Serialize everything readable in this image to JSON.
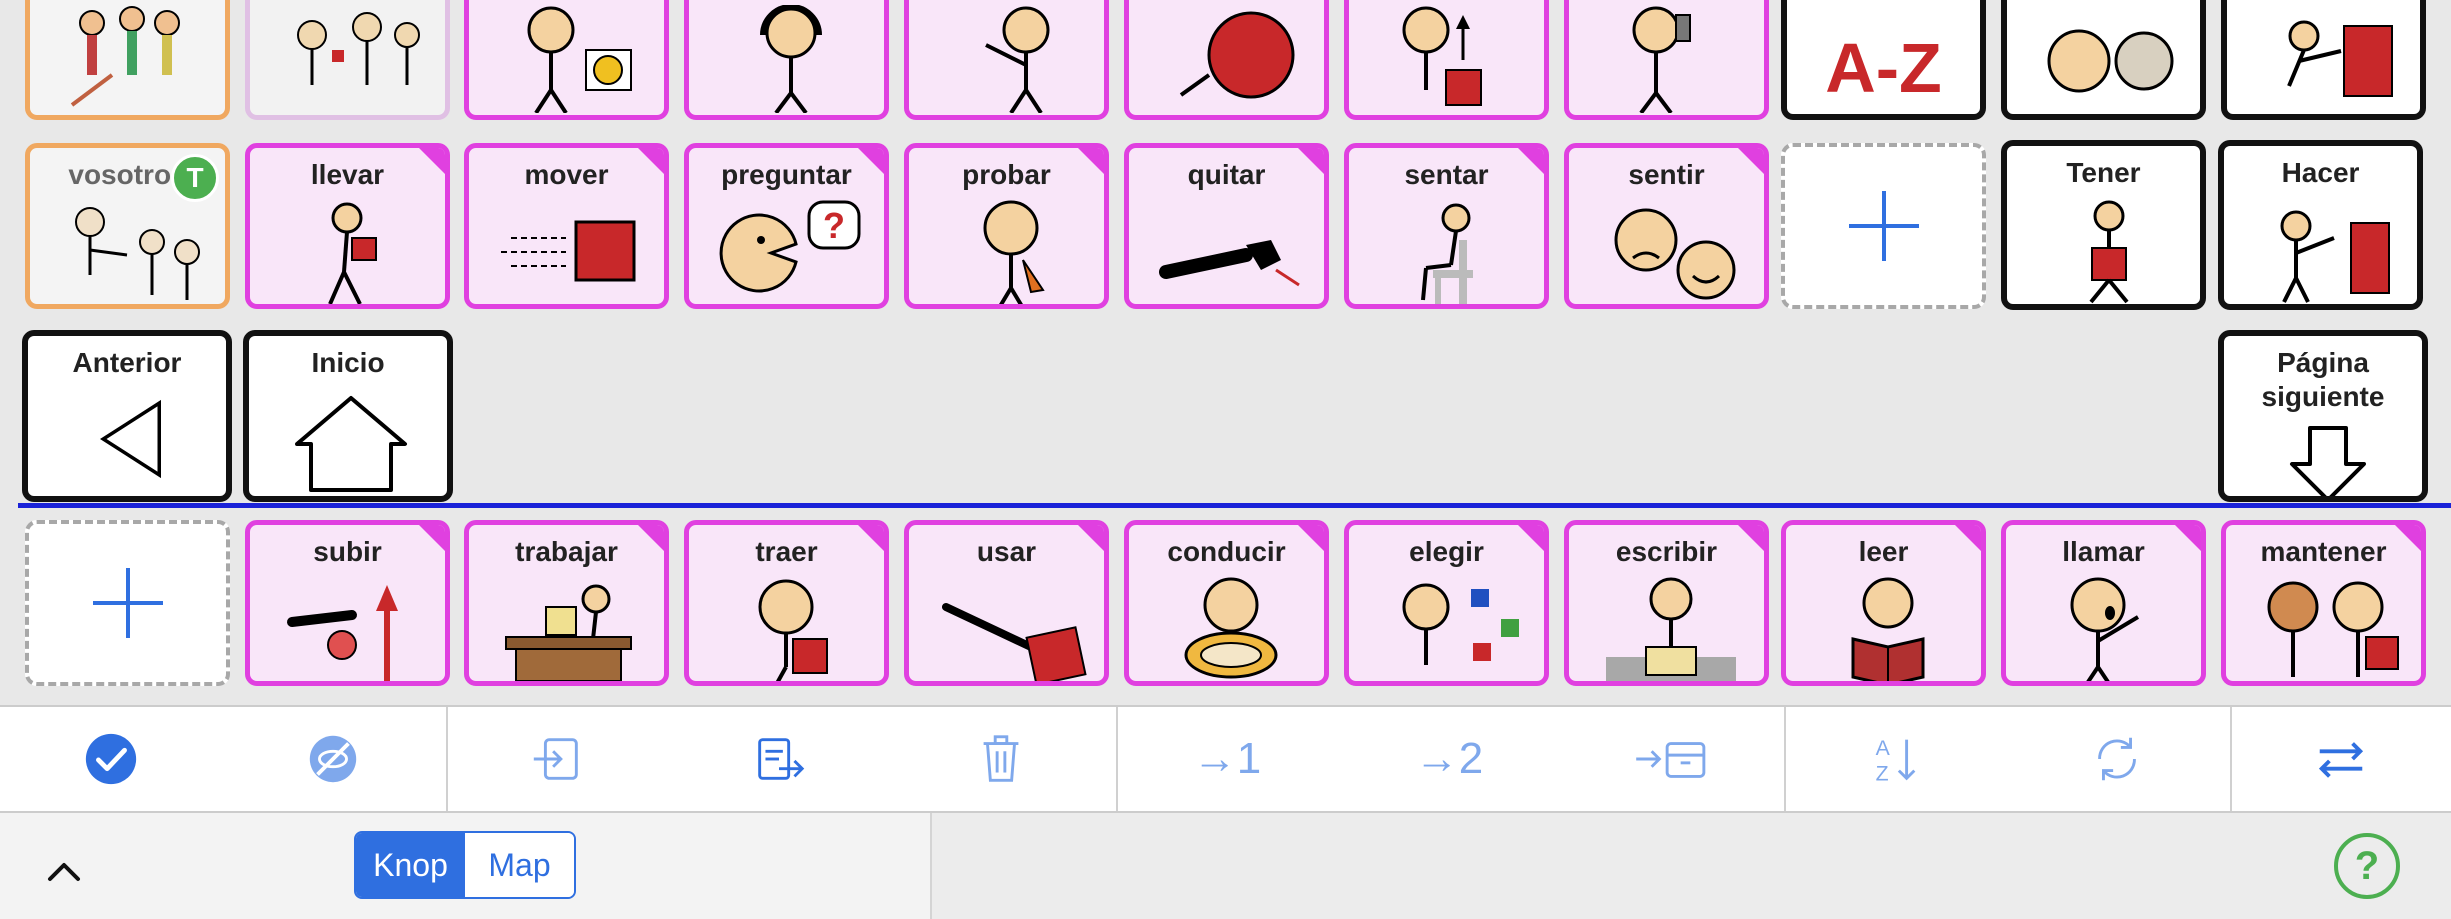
{
  "grid": {
    "row_top": [
      {
        "name": "top-tile-1",
        "label": ""
      },
      {
        "name": "top-tile-2",
        "label": ""
      },
      {
        "name": "top-tile-3",
        "label": ""
      },
      {
        "name": "top-tile-4",
        "label": ""
      },
      {
        "name": "top-tile-5",
        "label": ""
      },
      {
        "name": "top-tile-6",
        "label": ""
      },
      {
        "name": "top-tile-7",
        "label": ""
      },
      {
        "name": "top-tile-8",
        "label": ""
      },
      {
        "name": "top-tile-az",
        "label": "A-Z"
      },
      {
        "name": "top-tile-10",
        "label": ""
      },
      {
        "name": "top-tile-11",
        "label": ""
      }
    ],
    "row2": {
      "vosotros": "vosotros",
      "badge": "T",
      "verbs": [
        "llevar",
        "mover",
        "preguntar",
        "probar",
        "quitar",
        "sentar",
        "sentir"
      ],
      "tener": "Tener",
      "hacer": "Hacer"
    },
    "row3": {
      "anterior": "Anterior",
      "inicio": "Inicio",
      "pagina_siguiente": "Página siguiente"
    },
    "row4": {
      "verbs": [
        "subir",
        "trabajar",
        "traer",
        "usar",
        "conducir",
        "elegir",
        "escribir",
        "leer",
        "llamar",
        "mantener"
      ]
    }
  },
  "toolbar": {
    "icons": [
      "checkmark-icon",
      "hide-icon",
      "import-icon",
      "paste-icon",
      "trash-icon",
      "move-to-1-icon",
      "move-to-2-icon",
      "move-to-archive-icon",
      "sort-az-icon",
      "refresh-icon",
      "swap-icon"
    ],
    "move1": "→1",
    "move2": "→2"
  },
  "bottom": {
    "seg_knop": "Knop",
    "seg_map": "Map",
    "help": "?"
  },
  "colors": {
    "accent": "#2f6fe0",
    "verb_border": "#e040e0",
    "verb_bg": "#f9e6f9",
    "symbol_red": "#c8282a"
  }
}
